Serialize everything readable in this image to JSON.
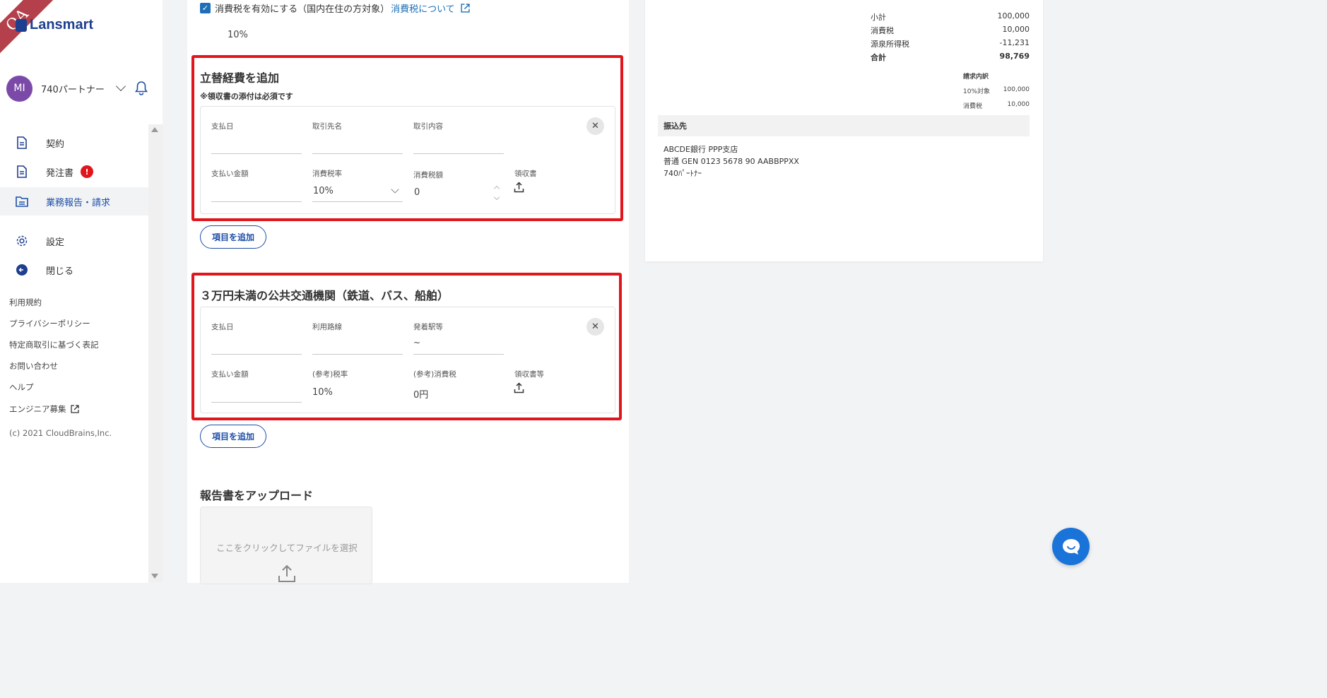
{
  "brand": {
    "qa_label": "QA",
    "logo_text": "Lansmart"
  },
  "user": {
    "initials": "MI",
    "name": "740パートナー"
  },
  "nav": {
    "contract": "契約",
    "orders": "発注書",
    "orders_badge": "!",
    "reports": "業務報告・請求",
    "settings": "設定",
    "close": "閉じる"
  },
  "footer": {
    "terms": "利用規約",
    "privacy": "プライバシーポリシー",
    "commerce": "特定商取引に基づく表記",
    "contact": "お問い合わせ",
    "help": "ヘルプ",
    "engineer": "エンジニア募集",
    "copyright": "(c) 2021 CloudBrains,Inc."
  },
  "tax": {
    "checkbox_label": "消費税を有効にする（国内在住の方対象）",
    "link": "消費税について",
    "rate": "10%"
  },
  "expenses": {
    "title": "立替経費を追加",
    "note": "※領収書の添付は必須です",
    "labels": {
      "date": "支払日",
      "vendor": "取引先名",
      "content": "取引内容",
      "amount": "支払い金額",
      "tax_rate": "消費税率",
      "tax_amount": "消費税額",
      "receipt": "領収書"
    },
    "values": {
      "tax_rate": "10%",
      "tax_amount": "0"
    },
    "add_button": "項目を追加"
  },
  "transit": {
    "title": "３万円未満の公共交通機関（鉄道、バス、船舶）",
    "labels": {
      "date": "支払日",
      "route": "利用路線",
      "stations": "発着駅等",
      "amount": "支払い金額",
      "ref_tax_rate": "(参考)税率",
      "ref_tax": "(参考)消費税",
      "receipt": "領収書等"
    },
    "values": {
      "stations": "~",
      "ref_tax_rate": "10%",
      "ref_tax": "0円"
    },
    "add_button": "項目を追加"
  },
  "upload": {
    "title": "報告書をアップロード",
    "dropzone": "ここをクリックしてファイルを選択"
  },
  "summary": {
    "subtotal_label": "小計",
    "subtotal": "100,000",
    "tax_label": "消費税",
    "tax": "10,000",
    "withholding_label": "源泉所得税",
    "withholding": "-11,231",
    "total_label": "合計",
    "total": "98,769",
    "breakdown_title": "請求内訳",
    "breakdown_10_label": "10%対象",
    "breakdown_10": "100,000",
    "breakdown_tax_label": "消費税",
    "breakdown_tax": "10,000"
  },
  "bank": {
    "header": "振込先",
    "line1": "ABCDE銀行 PPP支店",
    "line2": "普通 GEN 0123 5678 90 AABBPPXX",
    "line3": "740ﾊﾟｰﾄﾅｰ"
  },
  "colors": {
    "accent": "#1d4fa8",
    "highlight_border": "#e1151b",
    "badge": "#e0161c",
    "chat": "#1a73d9"
  }
}
